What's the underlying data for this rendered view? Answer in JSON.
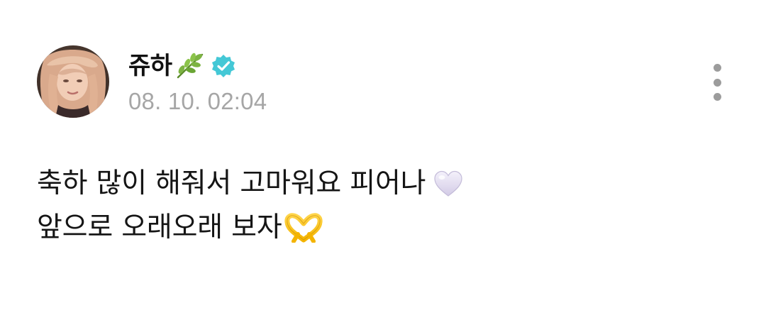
{
  "post": {
    "author": {
      "name": "쥬하",
      "name_emoji_icon": "leaf-icon",
      "verified_icon": "verified-badge-icon",
      "avatar_icon": "avatar-photo"
    },
    "timestamp": "08. 10. 02:04",
    "menu_icon": "more-vertical-icon",
    "body": {
      "line1": {
        "text": "축하 많이 해줘서 고마워요 피어나",
        "emoji_icon": "white-heart-icon"
      },
      "line2": {
        "text": "앞으로 오래오래 보자",
        "emoji_icon": "heart-hands-icon"
      }
    }
  },
  "colors": {
    "background": "#ffffff",
    "text": "#111111",
    "timestamp": "#a6a6a6",
    "verified": "#44c8d6",
    "menu_dots": "#9c9c9c"
  }
}
